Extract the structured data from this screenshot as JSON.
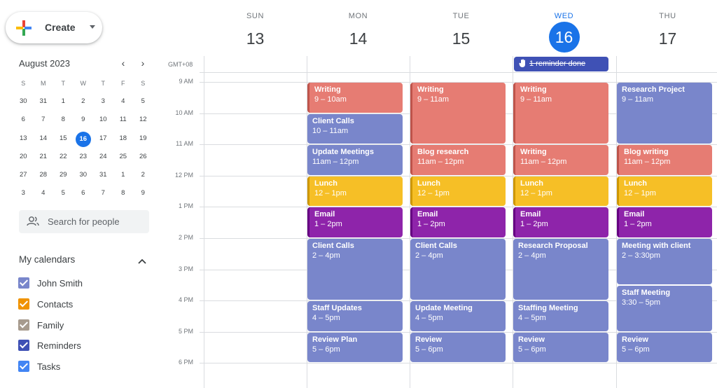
{
  "create": {
    "label": "Create"
  },
  "mini_calendar": {
    "month_label": "August 2023",
    "prev": "‹",
    "next": "›",
    "dow": [
      "S",
      "M",
      "T",
      "W",
      "T",
      "F",
      "S"
    ],
    "weeks": [
      [
        "30",
        "31",
        "1",
        "2",
        "3",
        "4",
        "5"
      ],
      [
        "6",
        "7",
        "8",
        "9",
        "10",
        "11",
        "12"
      ],
      [
        "13",
        "14",
        "15",
        "16",
        "17",
        "18",
        "19"
      ],
      [
        "20",
        "21",
        "22",
        "23",
        "24",
        "25",
        "26"
      ],
      [
        "27",
        "28",
        "29",
        "30",
        "31",
        "1",
        "2"
      ],
      [
        "3",
        "4",
        "5",
        "6",
        "7",
        "8",
        "9"
      ]
    ],
    "today": "16"
  },
  "search": {
    "placeholder": "Search for people"
  },
  "my_calendars": {
    "title": "My calendars",
    "items": [
      {
        "label": "John Smith",
        "color": "#7986cb"
      },
      {
        "label": "Contacts",
        "color": "#f09300"
      },
      {
        "label": "Family",
        "color": "#a79b8e"
      },
      {
        "label": "Reminders",
        "color": "#3f51b5"
      },
      {
        "label": "Tasks",
        "color": "#4285f4"
      }
    ]
  },
  "timezone": "GMT+08",
  "days": [
    {
      "dow": "SUN",
      "date": "13",
      "today": false
    },
    {
      "dow": "MON",
      "date": "14",
      "today": false
    },
    {
      "dow": "TUE",
      "date": "15",
      "today": false
    },
    {
      "dow": "WED",
      "date": "16",
      "today": true
    },
    {
      "dow": "THU",
      "date": "17",
      "today": false
    }
  ],
  "reminder": {
    "label": "1 reminder done"
  },
  "hours": [
    "9 AM",
    "10 AM",
    "11 AM",
    "12 PM",
    "1 PM",
    "2 PM",
    "3 PM",
    "4 PM",
    "5 PM",
    "6 PM"
  ],
  "colors": {
    "salmon": "#e67c73",
    "lavender": "#7986cb",
    "banana": "#f6bf26",
    "grape": "#8e24aa",
    "accent": "#1a73e8"
  },
  "events": [
    {
      "day": 1,
      "title": "Writing",
      "time": "9 – 10am",
      "start": 9,
      "end": 10,
      "color": "salmon"
    },
    {
      "day": 1,
      "title": "Client Calls",
      "time": "10 – 11am",
      "start": 10,
      "end": 11,
      "color": "lavender"
    },
    {
      "day": 1,
      "title": "Update Meetings",
      "time": "11am – 12pm",
      "start": 11,
      "end": 12,
      "color": "lavender"
    },
    {
      "day": 1,
      "title": "Lunch",
      "time": "12 – 1pm",
      "start": 12,
      "end": 13,
      "color": "banana"
    },
    {
      "day": 1,
      "title": "Email",
      "time": "1 – 2pm",
      "start": 13,
      "end": 14,
      "color": "grape"
    },
    {
      "day": 1,
      "title": "Client Calls",
      "time": "2 – 4pm",
      "start": 14,
      "end": 16,
      "color": "lavender"
    },
    {
      "day": 1,
      "title": "Staff Updates",
      "time": "4 – 5pm",
      "start": 16,
      "end": 17,
      "color": "lavender"
    },
    {
      "day": 1,
      "title": "Review Plan",
      "time": "5 – 6pm",
      "start": 17,
      "end": 18,
      "color": "lavender"
    },
    {
      "day": 2,
      "title": "Writing",
      "time": "9 – 11am",
      "start": 9,
      "end": 11,
      "color": "salmon"
    },
    {
      "day": 2,
      "title": "Blog research",
      "time": "11am – 12pm",
      "start": 11,
      "end": 12,
      "color": "salmon"
    },
    {
      "day": 2,
      "title": "Lunch",
      "time": "12 – 1pm",
      "start": 12,
      "end": 13,
      "color": "banana"
    },
    {
      "day": 2,
      "title": "Email",
      "time": "1 – 2pm",
      "start": 13,
      "end": 14,
      "color": "grape"
    },
    {
      "day": 2,
      "title": "Client Calls",
      "time": "2 – 4pm",
      "start": 14,
      "end": 16,
      "color": "lavender"
    },
    {
      "day": 2,
      "title": "Update Meeting",
      "time": "4 – 5pm",
      "start": 16,
      "end": 17,
      "color": "lavender"
    },
    {
      "day": 2,
      "title": "Review",
      "time": "5 – 6pm",
      "start": 17,
      "end": 18,
      "color": "lavender"
    },
    {
      "day": 3,
      "title": "Writing",
      "time": "9 – 11am",
      "start": 9,
      "end": 11,
      "color": "salmon"
    },
    {
      "day": 3,
      "title": "Writing",
      "time": "11am – 12pm",
      "start": 11,
      "end": 12,
      "color": "salmon"
    },
    {
      "day": 3,
      "title": "Lunch",
      "time": "12 – 1pm",
      "start": 12,
      "end": 13,
      "color": "banana"
    },
    {
      "day": 3,
      "title": "Email",
      "time": "1 – 2pm",
      "start": 13,
      "end": 14,
      "color": "grape"
    },
    {
      "day": 3,
      "title": "Research Proposal",
      "time": "2 – 4pm",
      "start": 14,
      "end": 16,
      "color": "lavender"
    },
    {
      "day": 3,
      "title": "Staffing Meeting",
      "time": "4 – 5pm",
      "start": 16,
      "end": 17,
      "color": "lavender"
    },
    {
      "day": 3,
      "title": "Review",
      "time": "5 – 6pm",
      "start": 17,
      "end": 18,
      "color": "lavender"
    },
    {
      "day": 4,
      "title": "Research Project",
      "time": "9 – 11am",
      "start": 9,
      "end": 11,
      "color": "lavender"
    },
    {
      "day": 4,
      "title": "Blog writing",
      "time": "11am – 12pm",
      "start": 11,
      "end": 12,
      "color": "salmon"
    },
    {
      "day": 4,
      "title": "Lunch",
      "time": "12 – 1pm",
      "start": 12,
      "end": 13,
      "color": "banana"
    },
    {
      "day": 4,
      "title": "Email",
      "time": "1 – 2pm",
      "start": 13,
      "end": 14,
      "color": "grape"
    },
    {
      "day": 4,
      "title": "Meeting with client",
      "time": "2 – 3:30pm",
      "start": 14,
      "end": 15.5,
      "color": "lavender"
    },
    {
      "day": 4,
      "title": "Staff Meeting",
      "time": "3:30 – 5pm",
      "start": 15.5,
      "end": 17,
      "color": "lavender"
    },
    {
      "day": 4,
      "title": "Review",
      "time": "5 – 6pm",
      "start": 17,
      "end": 18,
      "color": "lavender"
    }
  ]
}
